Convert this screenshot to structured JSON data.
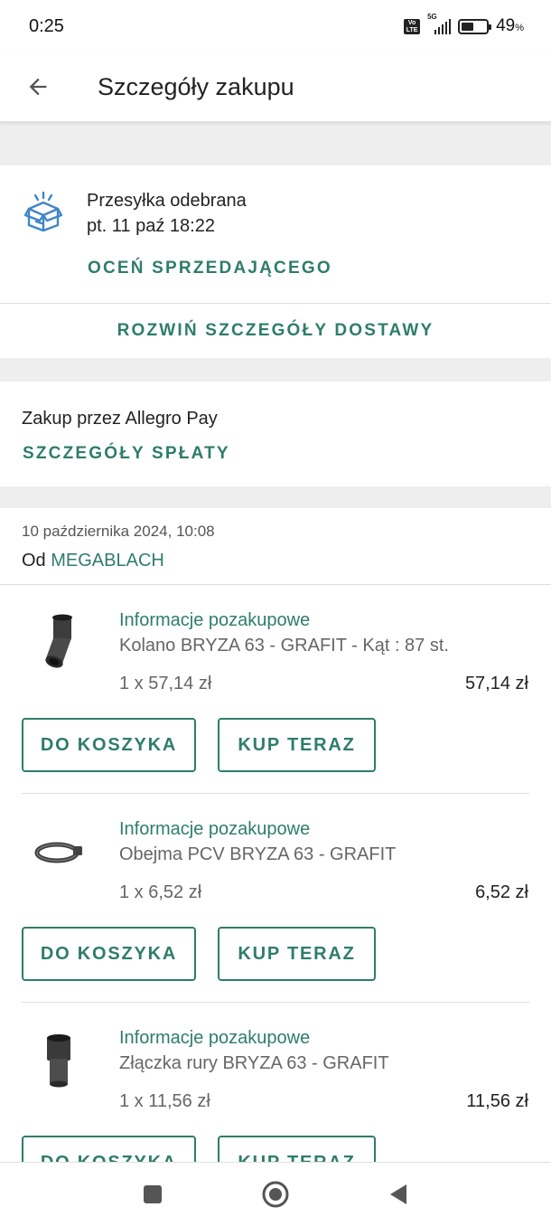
{
  "status_bar": {
    "time": "0:25",
    "network_label": "5G",
    "volte_label": "Vo LTE",
    "battery_level": 0.49,
    "battery_text": "49",
    "battery_unit": "%"
  },
  "header": {
    "title": "Szczegóły zakupu",
    "back_icon": "arrow-left-icon"
  },
  "delivery": {
    "icon": "open-box-icon",
    "status": "Przesyłka odebrana",
    "date": "pt. 11 paź 18:22",
    "rate_seller_label": "OCEŃ SPRZEDAJĄCEGO",
    "expand_label": "ROZWIŃ SZCZEGÓŁY DOSTAWY"
  },
  "payment": {
    "label": "Zakup przez Allegro Pay",
    "details_label": "SZCZEGÓŁY SPŁATY"
  },
  "order": {
    "date": "10 października 2024, 10:08",
    "seller_prefix": "Od",
    "seller_name": "MEGABLACH",
    "items": [
      {
        "info_label": "Informacje pozakupowe",
        "name": "Kolano BRYZA 63 - GRAFIT - Kąt : 87 st.",
        "qty_price": "1 x 57,14 zł",
        "total": "57,14 zł",
        "cart_label": "DO KOSZYKA",
        "buy_label": "KUP TERAZ"
      },
      {
        "info_label": "Informacje pozakupowe",
        "name": "Obejma PCV BRYZA 63 - GRAFIT",
        "qty_price": "1 x 6,52 zł",
        "total": "6,52 zł",
        "cart_label": "DO KOSZYKA",
        "buy_label": "KUP TERAZ"
      },
      {
        "info_label": "Informacje pozakupowe",
        "name": "Złączka rury BRYZA 63 - GRAFIT",
        "qty_price": "1 x 11,56 zł",
        "total": "11,56 zł",
        "cart_label": "DO KOSZYKA",
        "buy_label": "KUP TERAZ"
      }
    ]
  },
  "colors": {
    "accent": "#2e7d6a",
    "icon_blue": "#3f86c6",
    "section_gap": "#eeeeee"
  }
}
